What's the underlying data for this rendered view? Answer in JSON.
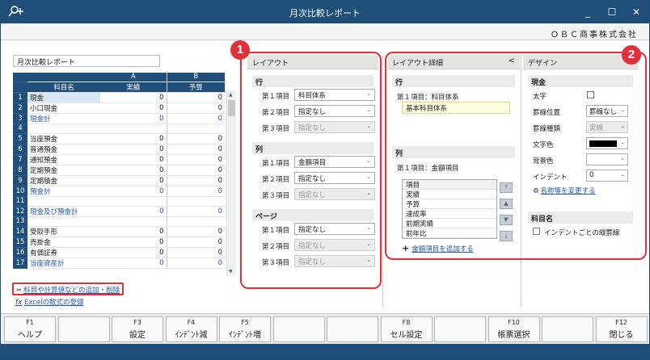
{
  "window": {
    "title": "月次比較レポート",
    "company": "ＯＢＣ商事株式会社",
    "controls": [
      "_",
      "☐",
      "✕"
    ]
  },
  "report_name": "月次比較レポート",
  "grid": {
    "col_a": "A",
    "col_b": "B",
    "header": {
      "name": "科目名",
      "a": "実績",
      "b": "予算"
    },
    "rows": [
      {
        "n": "1",
        "name": "現金",
        "a": "0",
        "b": "0",
        "blue": false
      },
      {
        "n": "2",
        "name": "小口現金",
        "a": "0",
        "b": "0",
        "blue": false
      },
      {
        "n": "3",
        "name": "現金計",
        "a": "0",
        "b": "0",
        "blue": true
      },
      {
        "n": "4",
        "name": "",
        "a": "",
        "b": "",
        "blue": false
      },
      {
        "n": "5",
        "name": "当座預金",
        "a": "0",
        "b": "0",
        "blue": false
      },
      {
        "n": "6",
        "name": "普通預金",
        "a": "0",
        "b": "0",
        "blue": false
      },
      {
        "n": "7",
        "name": "通知預金",
        "a": "0",
        "b": "0",
        "blue": false
      },
      {
        "n": "8",
        "name": "定期預金",
        "a": "0",
        "b": "0",
        "blue": false
      },
      {
        "n": "9",
        "name": "定期積金",
        "a": "0",
        "b": "0",
        "blue": false
      },
      {
        "n": "10",
        "name": "預金計",
        "a": "0",
        "b": "0",
        "blue": true
      },
      {
        "n": "11",
        "name": "",
        "a": "",
        "b": "",
        "blue": false
      },
      {
        "n": "12",
        "name": "現金及び預金計",
        "a": "0",
        "b": "0",
        "blue": true
      },
      {
        "n": "13",
        "name": "",
        "a": "",
        "b": "",
        "blue": false
      },
      {
        "n": "14",
        "name": "受取手形",
        "a": "0",
        "b": "0",
        "blue": false
      },
      {
        "n": "15",
        "name": "売掛金",
        "a": "0",
        "b": "0",
        "blue": false
      },
      {
        "n": "16",
        "name": "有価証券",
        "a": "0",
        "b": "0",
        "blue": false
      },
      {
        "n": "17",
        "name": "当座資産計",
        "a": "0",
        "b": "0",
        "blue": true
      }
    ]
  },
  "links": {
    "add_subject": "科目や計算値などの追加・削除",
    "excel_formula": "Excelの数式の登録",
    "excel_icon": "fx"
  },
  "layout_panel": {
    "title": "レイアウト",
    "sections": [
      {
        "name": "行",
        "items": [
          {
            "label": "第１項目",
            "value": "科目体系",
            "disabled": false
          },
          {
            "label": "第２項目",
            "value": "指定なし",
            "disabled": false
          },
          {
            "label": "第３項目",
            "value": "指定なし",
            "disabled": true
          }
        ]
      },
      {
        "name": "列",
        "items": [
          {
            "label": "第１項目",
            "value": "金額項目",
            "disabled": false
          },
          {
            "label": "第２項目",
            "value": "指定なし",
            "disabled": false
          },
          {
            "label": "第３項目",
            "value": "指定なし",
            "disabled": true
          }
        ]
      },
      {
        "name": "ページ",
        "items": [
          {
            "label": "第１項目",
            "value": "指定なし",
            "disabled": false
          },
          {
            "label": "第２項目",
            "value": "指定なし",
            "disabled": true
          },
          {
            "label": "第３項目",
            "value": "指定なし",
            "disabled": true
          }
        ]
      }
    ]
  },
  "detail_panel": {
    "title": "レイアウト詳細",
    "collapse": "<",
    "row_section": "行",
    "row_line": "第１項目：科目体系",
    "row_value": "基本科目体系",
    "col_section": "列",
    "col_line": "第１項目：金額項目",
    "items_header": "項目",
    "items": [
      "実績",
      "予算",
      "達成率",
      "前期実績",
      "前年比"
    ],
    "add_item": "金額項目を追加する"
  },
  "design_panel": {
    "title": "デザイン",
    "money_section": "現金",
    "bold_label": "太字",
    "border_pos_label": "罫線位置",
    "border_pos_value": "罫線なし",
    "border_type_label": "罫線種類",
    "border_type_value": "実線",
    "text_color_label": "文字色",
    "bg_color_label": "背景色",
    "indent_label": "インデント",
    "indent_value": "0",
    "rename_link": "名称等を変更する",
    "subject_section": "科目名",
    "indent_border_label": "インデントごとの縦罫線",
    "text_color_hex": "#000000"
  },
  "callouts": [
    "1",
    "2"
  ],
  "fkeys": [
    {
      "k": "F1",
      "l": "ヘルプ"
    },
    {
      "k": "",
      "l": ""
    },
    {
      "k": "F3",
      "l": "設定"
    },
    {
      "k": "F4",
      "l": "ｲﾝﾃﾞﾝﾄ減"
    },
    {
      "k": "F5",
      "l": "ｲﾝﾃﾞﾝﾄ増"
    },
    {
      "k": "",
      "l": ""
    },
    {
      "k": "",
      "l": ""
    },
    {
      "k": "F8",
      "l": "セル設定"
    },
    {
      "k": "",
      "l": ""
    },
    {
      "k": "F10",
      "l": "帳票選択"
    },
    {
      "k": "",
      "l": ""
    },
    {
      "k": "F12",
      "l": "閉じる"
    }
  ]
}
